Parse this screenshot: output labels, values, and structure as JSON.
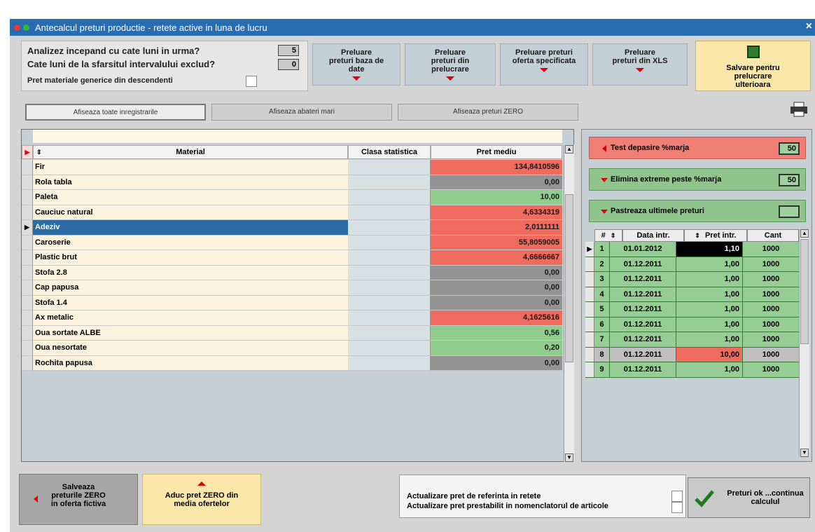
{
  "window": {
    "title": "Antecalcul preturi productie - retete active in luna de lucru"
  },
  "settings": {
    "months_back_label": "Analizez incepand cu cate luni in urma?",
    "months_back_value": "5",
    "months_excluded_label": "Cate luni de la sfarsitul intervalului exclud?",
    "months_excluded_value": "0",
    "generic_materials_label": "Pret materiale generice din descendenti"
  },
  "toolbar": {
    "btn_db": "Preluare preturi baza de date",
    "btn_processing": "Preluare preturi din prelucrare",
    "btn_offer": "Preluare preturi oferta specificata",
    "btn_xls": "Preluare preturi din XLS",
    "btn_save_later": "Salvare pentru prelucrare ulterioara"
  },
  "filters": {
    "show_all": "Afiseaza toate inregistrarile",
    "show_deviations": "Afiseaza abateri mari",
    "show_zero": "Afiseaza preturi ZERO"
  },
  "main_grid": {
    "headers": {
      "material": "Material",
      "class": "Clasa statistica",
      "price": "Pret mediu"
    },
    "rows": [
      {
        "material": "Fir",
        "price": "134,8410596",
        "color": "#ef6b5d"
      },
      {
        "material": "Rola tabla",
        "price": "0,00",
        "color": "#939393"
      },
      {
        "material": "Paleta",
        "price": "10,00",
        "color": "#90cd8d"
      },
      {
        "material": "Cauciuc natural",
        "price": "4,6334319",
        "color": "#ef6b5d"
      },
      {
        "material": "Adeziv",
        "price": "2,0111111",
        "color": "#ef6b5d",
        "selected": true
      },
      {
        "material": "Caroserie",
        "price": "55,8059005",
        "color": "#ef6b5d"
      },
      {
        "material": "Plastic brut",
        "price": "4,6666667",
        "color": "#ef6b5d"
      },
      {
        "material": "Stofa 2.8",
        "price": "0,00",
        "color": "#939393"
      },
      {
        "material": "Cap papusa",
        "price": "0,00",
        "color": "#939393"
      },
      {
        "material": "Stofa 1.4",
        "price": "0,00",
        "color": "#939393"
      },
      {
        "material": "Ax metalic",
        "price": "4,1625616",
        "color": "#ef6b5d"
      },
      {
        "material": "Oua sortate ALBE",
        "price": "0,56",
        "color": "#90cd8d"
      },
      {
        "material": "Oua nesortate",
        "price": "0,20",
        "color": "#90cd8d"
      },
      {
        "material": "Rochita papusa",
        "price": "0,00",
        "color": "#939393"
      }
    ]
  },
  "right_panel": {
    "test_label": "Test depasire %marja",
    "test_value": "50",
    "eliminate_label": "Elimina extreme peste %marja",
    "eliminate_value": "50",
    "keep_label": "Pastreaza ultimele preturi",
    "keep_value": "",
    "sub_grid": {
      "headers": {
        "no": "#",
        "date": "Data intr.",
        "price": "Pret intr.",
        "qty": "Cant"
      },
      "rows": [
        {
          "no": "1",
          "date": "01.01.2012",
          "price": "1,10",
          "qty": "1000",
          "date_dark": true,
          "price_style": "black"
        },
        {
          "no": "2",
          "date": "01.12.2011",
          "price": "1,00",
          "qty": "1000"
        },
        {
          "no": "3",
          "date": "01.12.2011",
          "price": "1,00",
          "qty": "1000"
        },
        {
          "no": "4",
          "date": "01.12.2011",
          "price": "1,00",
          "qty": "1000"
        },
        {
          "no": "5",
          "date": "01.12.2011",
          "price": "1,00",
          "qty": "1000"
        },
        {
          "no": "6",
          "date": "01.12.2011",
          "price": "1,00",
          "qty": "1000"
        },
        {
          "no": "7",
          "date": "01.12.2011",
          "price": "1,00",
          "qty": "1000"
        },
        {
          "no": "8",
          "date": "01.12.2011",
          "price": "10,00",
          "qty": "1000",
          "price_style": "red",
          "row_gray": true
        },
        {
          "no": "9",
          "date": "01.12.2011",
          "price": "1,00",
          "qty": "1000"
        }
      ]
    }
  },
  "bottom": {
    "save_zero": "Salveaza preturile ZERO in oferta fictiva",
    "bring_zero": "Aduc pret ZERO din media ofertelor",
    "update_reference": "Actualizare pret de referinta in retete",
    "update_default": "Actualizare pret prestabilit in nomenclatorul de articole",
    "prices_ok": "Preturi ok ...continua calculul"
  }
}
